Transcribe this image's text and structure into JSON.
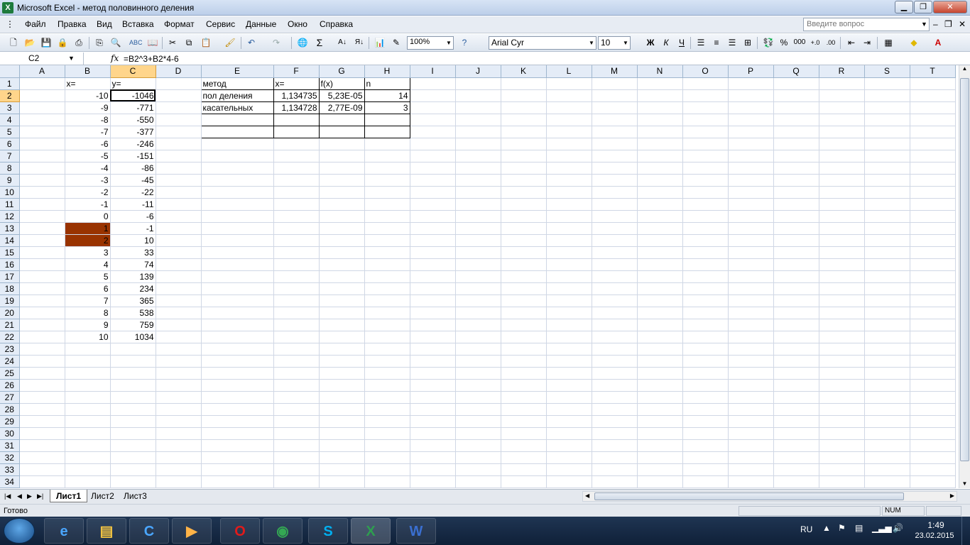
{
  "window": {
    "title": "Microsoft Excel - метод половинного деления",
    "app_icon": "X"
  },
  "menu": [
    "Файл",
    "Правка",
    "Вид",
    "Вставка",
    "Формат",
    "Сервис",
    "Данные",
    "Окно",
    "Справка"
  ],
  "help_box": {
    "placeholder": "Введите вопрос"
  },
  "toolbar": {
    "zoom": "100%",
    "font": "Arial Cyr",
    "font_size": "10",
    "bold": "Ж",
    "italic": "К",
    "underline": "Ч",
    "percent": "%",
    "thousands": "000"
  },
  "formula_bar": {
    "cell_ref": "C2",
    "fx": "fx",
    "formula": "=B2^3+B2*4-6"
  },
  "columns": [
    "A",
    "B",
    "C",
    "D",
    "E",
    "F",
    "G",
    "H",
    "I",
    "J",
    "K",
    "L",
    "M",
    "N",
    "O",
    "P",
    "Q",
    "R",
    "S",
    "T"
  ],
  "rows": [
    {
      "n": "1",
      "A": "",
      "B": "x=",
      "C": "y=",
      "D": "",
      "E": "метод",
      "F": "x=",
      "G": "f(x)",
      "H": "n"
    },
    {
      "n": "2",
      "A": "",
      "B": "-10",
      "C": "-1046",
      "D": "",
      "E": "пол деления",
      "F": "1,134735",
      "G": "5,23E-05",
      "H": "14"
    },
    {
      "n": "3",
      "A": "",
      "B": "-9",
      "C": "-771",
      "D": "",
      "E": "касательных",
      "F": "1,134728",
      "G": "2,77E-09",
      "H": "3"
    },
    {
      "n": "4",
      "A": "",
      "B": "-8",
      "C": "-550",
      "D": "",
      "E": "",
      "F": "",
      "G": "",
      "H": ""
    },
    {
      "n": "5",
      "A": "",
      "B": "-7",
      "C": "-377",
      "D": "",
      "E": "",
      "F": "",
      "G": "",
      "H": ""
    },
    {
      "n": "6",
      "A": "",
      "B": "-6",
      "C": "-246"
    },
    {
      "n": "7",
      "A": "",
      "B": "-5",
      "C": "-151"
    },
    {
      "n": "8",
      "A": "",
      "B": "-4",
      "C": "-86"
    },
    {
      "n": "9",
      "A": "",
      "B": "-3",
      "C": "-45"
    },
    {
      "n": "10",
      "A": "",
      "B": "-2",
      "C": "-22"
    },
    {
      "n": "11",
      "A": "",
      "B": "-1",
      "C": "-11"
    },
    {
      "n": "12",
      "A": "",
      "B": "0",
      "C": "-6"
    },
    {
      "n": "13",
      "A": "",
      "B": "1",
      "C": "-1"
    },
    {
      "n": "14",
      "A": "",
      "B": "2",
      "C": "10"
    },
    {
      "n": "15",
      "A": "",
      "B": "3",
      "C": "33"
    },
    {
      "n": "16",
      "A": "",
      "B": "4",
      "C": "74"
    },
    {
      "n": "17",
      "A": "",
      "B": "5",
      "C": "139"
    },
    {
      "n": "18",
      "A": "",
      "B": "6",
      "C": "234"
    },
    {
      "n": "19",
      "A": "",
      "B": "7",
      "C": "365"
    },
    {
      "n": "20",
      "A": "",
      "B": "8",
      "C": "538"
    },
    {
      "n": "21",
      "A": "",
      "B": "9",
      "C": "759"
    },
    {
      "n": "22",
      "A": "",
      "B": "10",
      "C": "1034"
    },
    {
      "n": "23"
    },
    {
      "n": "24"
    },
    {
      "n": "25"
    },
    {
      "n": "26"
    },
    {
      "n": "27"
    },
    {
      "n": "28"
    },
    {
      "n": "29"
    },
    {
      "n": "30"
    },
    {
      "n": "31"
    },
    {
      "n": "32"
    },
    {
      "n": "33"
    },
    {
      "n": "34"
    }
  ],
  "active_cell": {
    "row": "2",
    "col": "C"
  },
  "highlight_color": "#993300",
  "sheets": [
    "Лист1",
    "Лист2",
    "Лист3"
  ],
  "status": {
    "text": "Готово",
    "num": "NUM"
  },
  "taskbar": {
    "apps": [
      "ie-icon",
      "explorer-icon",
      "ccleaner-icon",
      "media-player-icon",
      "opera-icon",
      "chrome-icon",
      "skype-icon",
      "excel-icon",
      "word-icon"
    ],
    "lang": "RU",
    "time": "1:49",
    "date": "23.02.2015"
  }
}
